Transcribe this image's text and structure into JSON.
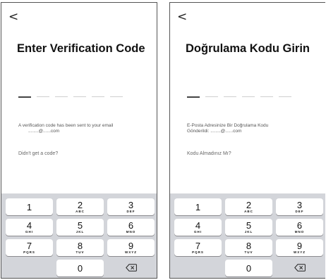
{
  "screens": [
    {
      "id": "en",
      "back_glyph": "<",
      "title": "Enter Verification Code",
      "code_slots": 6,
      "info_line1": "A verification code has been sent to your email",
      "info_line2": "........@......com",
      "resend": "Didn't get a code?"
    },
    {
      "id": "tr",
      "back_glyph": "<",
      "title": "Doğrulama Kodu Girin",
      "code_slots": 6,
      "info_line1": "E-Posta Adresinize Bir Doğrulama Kodu",
      "info_line2": "Gönderildi: ........@......com",
      "resend": "Kodu Almadınız Mı?"
    }
  ],
  "keypad": {
    "keys": [
      {
        "digit": "1",
        "letters": ""
      },
      {
        "digit": "2",
        "letters": "ABC"
      },
      {
        "digit": "3",
        "letters": "DEF"
      },
      {
        "digit": "4",
        "letters": "GHI"
      },
      {
        "digit": "5",
        "letters": "JKL"
      },
      {
        "digit": "6",
        "letters": "MNO"
      },
      {
        "digit": "7",
        "letters": "PQRS"
      },
      {
        "digit": "8",
        "letters": "TUV"
      },
      {
        "digit": "9",
        "letters": "WXYZ"
      },
      {
        "digit": "0",
        "letters": ""
      }
    ],
    "delete_icon": "backspace-icon"
  },
  "colors": {
    "keypad_bg": "#d3d5da",
    "key_bg": "#ffffff",
    "active_slot": "#444444",
    "inactive_slot": "#cfcfcf"
  }
}
